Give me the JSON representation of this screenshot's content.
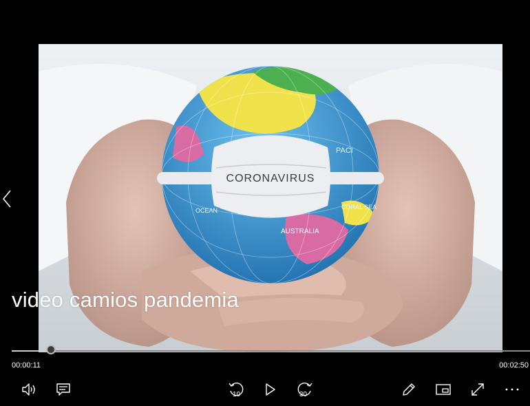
{
  "video": {
    "title": "video camios pandemia",
    "frame_caption": "CORONAVIRUS",
    "globe_labels": [
      "PACI",
      "OCEAN",
      "AUSTRALIA",
      "CORAL SEA"
    ]
  },
  "playback": {
    "current_time": "00:00:11",
    "total_time": "00:02:50",
    "progress_fraction": 0.076
  },
  "controls": {
    "skip_back_seconds": "10",
    "skip_forward_seconds": "30",
    "icons": [
      "volume-icon",
      "subtitles-icon",
      "skip-back-icon",
      "play-icon",
      "skip-forward-icon",
      "edit-pen-icon",
      "mini-view-icon",
      "fullscreen-icon",
      "more-options-icon"
    ]
  },
  "colors": {
    "background": "#000000",
    "ocean": "#3c9fd8",
    "land_yellow": "#f0e24a",
    "land_green": "#4caf50",
    "land_pink": "#d86aa4",
    "mask": "#e9ebee"
  }
}
